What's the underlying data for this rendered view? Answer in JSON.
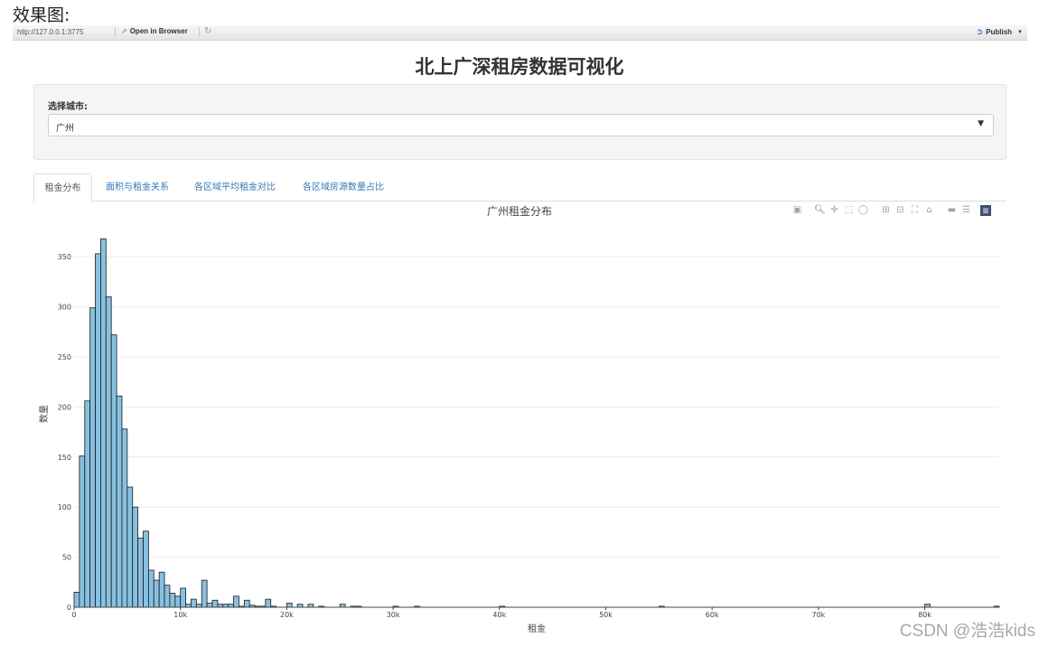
{
  "caption": "效果图:",
  "topbar": {
    "url": "http://127.0.0.1:3775",
    "open_label": "Open in Browser",
    "publish_label": "Publish"
  },
  "title": "北上广深租房数据可视化",
  "city_select": {
    "label": "选择城市:",
    "value": "广州"
  },
  "tabs": [
    {
      "label": "租金分布",
      "active": true
    },
    {
      "label": "面积与租金关系",
      "active": false
    },
    {
      "label": "各区域平均租金对比",
      "active": false
    },
    {
      "label": "各区域房源数量占比",
      "active": false
    }
  ],
  "watermark": "CSDN @浩浩kids",
  "colors": {
    "bar_fill": "#87c1e1",
    "bar_stroke": "#1a1a1a",
    "tab_link": "#337ab7",
    "modebar_logo": "#3f4f75"
  },
  "chart_data": {
    "type": "bar",
    "title": "广州租金分布",
    "xlabel": "租金",
    "ylabel": "数量",
    "bin_width": 500,
    "xlim": [
      0,
      87000
    ],
    "ylim": [
      0,
      370
    ],
    "xticks": [
      0,
      10000,
      20000,
      30000,
      40000,
      50000,
      60000,
      70000,
      80000
    ],
    "xtick_labels": [
      "0",
      "10k",
      "20k",
      "30k",
      "40k",
      "50k",
      "60k",
      "70k",
      "80k"
    ],
    "yticks": [
      0,
      50,
      100,
      150,
      200,
      250,
      300,
      350
    ],
    "grid": true,
    "bins": [
      {
        "x": 0,
        "y": 15
      },
      {
        "x": 500,
        "y": 151
      },
      {
        "x": 1000,
        "y": 206
      },
      {
        "x": 1500,
        "y": 299
      },
      {
        "x": 2000,
        "y": 353
      },
      {
        "x": 2500,
        "y": 368
      },
      {
        "x": 3000,
        "y": 310
      },
      {
        "x": 3500,
        "y": 272
      },
      {
        "x": 4000,
        "y": 211
      },
      {
        "x": 4500,
        "y": 178
      },
      {
        "x": 5000,
        "y": 120
      },
      {
        "x": 5500,
        "y": 100
      },
      {
        "x": 6000,
        "y": 69
      },
      {
        "x": 6500,
        "y": 76
      },
      {
        "x": 7000,
        "y": 37
      },
      {
        "x": 7500,
        "y": 27
      },
      {
        "x": 8000,
        "y": 35
      },
      {
        "x": 8500,
        "y": 22
      },
      {
        "x": 9000,
        "y": 14
      },
      {
        "x": 9500,
        "y": 11
      },
      {
        "x": 10000,
        "y": 19
      },
      {
        "x": 10500,
        "y": 3
      },
      {
        "x": 11000,
        "y": 8
      },
      {
        "x": 11500,
        "y": 3
      },
      {
        "x": 12000,
        "y": 27
      },
      {
        "x": 12500,
        "y": 4
      },
      {
        "x": 13000,
        "y": 7
      },
      {
        "x": 13500,
        "y": 3
      },
      {
        "x": 14000,
        "y": 3
      },
      {
        "x": 14500,
        "y": 3
      },
      {
        "x": 15000,
        "y": 11
      },
      {
        "x": 15500,
        "y": 1
      },
      {
        "x": 16000,
        "y": 7
      },
      {
        "x": 16500,
        "y": 2
      },
      {
        "x": 17000,
        "y": 1
      },
      {
        "x": 17500,
        "y": 1
      },
      {
        "x": 18000,
        "y": 8
      },
      {
        "x": 18500,
        "y": 1
      },
      {
        "x": 20000,
        "y": 4
      },
      {
        "x": 21000,
        "y": 3
      },
      {
        "x": 22000,
        "y": 3
      },
      {
        "x": 23000,
        "y": 1
      },
      {
        "x": 25000,
        "y": 3
      },
      {
        "x": 26000,
        "y": 1
      },
      {
        "x": 26500,
        "y": 1
      },
      {
        "x": 30000,
        "y": 1
      },
      {
        "x": 32000,
        "y": 1
      },
      {
        "x": 40000,
        "y": 1
      },
      {
        "x": 55000,
        "y": 1
      },
      {
        "x": 80000,
        "y": 3
      },
      {
        "x": 86500,
        "y": 1
      }
    ]
  }
}
